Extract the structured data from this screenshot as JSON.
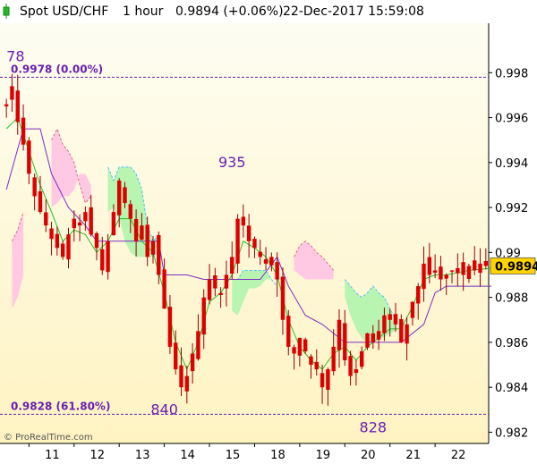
{
  "header": {
    "symbol": "Spot USD/CHF",
    "timeframe": "1 hour",
    "price_change": "0.9894 (+0.06%)",
    "datetime": "22-Dec-2017 15:59:08"
  },
  "credit": "© ProRealTime.com",
  "chart_data": {
    "type": "candlestick",
    "ylim": [
      0.9815,
      1.0002
    ],
    "yticks": [
      "0.998",
      "0.996",
      "0.994",
      "0.992",
      "0.99",
      "0.988",
      "0.986",
      "0.984",
      "0.982"
    ],
    "ytick_values": [
      0.998,
      0.996,
      0.994,
      0.992,
      0.99,
      0.988,
      0.986,
      0.984,
      0.982
    ],
    "xticks": [
      "11",
      "12",
      "13",
      "14",
      "15",
      "18",
      "19",
      "20",
      "21",
      "22"
    ],
    "xtick_bars": [
      8,
      16,
      24,
      32,
      40,
      48,
      56,
      64,
      72,
      80
    ],
    "total_bars": 86,
    "last_price": "0.9894",
    "last_price_value": 0.9894,
    "fib_levels": [
      {
        "label": "0.9978 (0.00%)",
        "value": 0.9978
      },
      {
        "label": "0.9828 (61.80%)",
        "value": 0.9828
      }
    ],
    "annotations": [
      {
        "text": "78",
        "bar": 0,
        "value": 0.9985
      },
      {
        "text": "935",
        "bar": 40,
        "value": 0.9938
      },
      {
        "text": "840",
        "bar": 28,
        "value": 0.9828
      },
      {
        "text": "828",
        "bar": 65,
        "value": 0.982
      }
    ],
    "close_path": [
      [
        0,
        0.9965
      ],
      [
        1,
        0.9974
      ],
      [
        2,
        0.9958
      ],
      [
        3,
        0.9948
      ],
      [
        4,
        0.9935
      ],
      [
        5,
        0.9925
      ],
      [
        6,
        0.9918
      ],
      [
        7,
        0.9912
      ],
      [
        8,
        0.9906
      ],
      [
        9,
        0.9902
      ],
      [
        10,
        0.9898
      ],
      [
        11,
        0.9908
      ],
      [
        12,
        0.9915
      ],
      [
        13,
        0.9912
      ],
      [
        14,
        0.9918
      ],
      [
        15,
        0.9908
      ],
      [
        16,
        0.9902
      ],
      [
        17,
        0.9892
      ],
      [
        18,
        0.9905
      ],
      [
        19,
        0.9918
      ],
      [
        20,
        0.9932
      ],
      [
        21,
        0.9922
      ],
      [
        22,
        0.9915
      ],
      [
        23,
        0.9905
      ],
      [
        24,
        0.9912
      ],
      [
        25,
        0.9898
      ],
      [
        26,
        0.9905
      ],
      [
        27,
        0.989
      ],
      [
        28,
        0.9875
      ],
      [
        29,
        0.9858
      ],
      [
        30,
        0.9848
      ],
      [
        31,
        0.984
      ],
      [
        32,
        0.9845
      ],
      [
        33,
        0.9855
      ],
      [
        34,
        0.9865
      ],
      [
        35,
        0.988
      ],
      [
        36,
        0.9888
      ],
      [
        37,
        0.9884
      ],
      [
        38,
        0.9882
      ],
      [
        39,
        0.989
      ],
      [
        40,
        0.9898
      ],
      [
        41,
        0.9915
      ],
      [
        42,
        0.9912
      ],
      [
        43,
        0.9905
      ],
      [
        44,
        0.9902
      ],
      [
        45,
        0.9898
      ],
      [
        46,
        0.9895
      ],
      [
        47,
        0.9898
      ],
      [
        48,
        0.9888
      ],
      [
        49,
        0.987
      ],
      [
        50,
        0.9858
      ],
      [
        51,
        0.9855
      ],
      [
        52,
        0.9862
      ],
      [
        53,
        0.9856
      ],
      [
        54,
        0.985
      ],
      [
        55,
        0.9848
      ],
      [
        56,
        0.984
      ],
      [
        57,
        0.9848
      ],
      [
        58,
        0.9858
      ],
      [
        59,
        0.987
      ],
      [
        60,
        0.9852
      ],
      [
        61,
        0.9845
      ],
      [
        62,
        0.9848
      ],
      [
        63,
        0.9856
      ],
      [
        64,
        0.9864
      ],
      [
        65,
        0.986
      ],
      [
        66,
        0.9865
      ],
      [
        67,
        0.9872
      ],
      [
        68,
        0.987
      ],
      [
        69,
        0.9868
      ],
      [
        70,
        0.986
      ],
      [
        71,
        0.9868
      ],
      [
        72,
        0.9878
      ],
      [
        73,
        0.9885
      ],
      [
        74,
        0.9895
      ],
      [
        75,
        0.989
      ],
      [
        76,
        0.9892
      ],
      [
        77,
        0.9888
      ],
      [
        78,
        0.989
      ],
      [
        79,
        0.9892
      ],
      [
        80,
        0.9893
      ],
      [
        81,
        0.989
      ],
      [
        82,
        0.9894
      ],
      [
        83,
        0.9892
      ],
      [
        84,
        0.9895
      ],
      [
        85,
        0.9894
      ]
    ],
    "green_cloud": [
      {
        "x": [
          18,
          27
        ],
        "top": [
          0.9938,
          0.9932,
          0.9938,
          0.9938,
          0.9938,
          0.9935,
          0.9928,
          0.9912,
          0.9905,
          0.9908
        ],
        "bottom": [
          0.9918,
          0.992,
          0.9915,
          0.9905,
          0.99,
          0.9898,
          0.9898,
          0.9898,
          0.9898,
          0.9902
        ]
      },
      {
        "x": [
          40,
          48
        ],
        "top": [
          0.9888,
          0.9888,
          0.9892,
          0.9892,
          0.9892,
          0.9892,
          0.9892,
          0.9888,
          0.9885
        ],
        "bottom": [
          0.9874,
          0.9872,
          0.9878,
          0.9884,
          0.9884,
          0.9885,
          0.9888,
          0.9888,
          0.9885
        ]
      },
      {
        "x": [
          60,
          69
        ],
        "top": [
          0.9888,
          0.9885,
          0.9882,
          0.988,
          0.9882,
          0.9885,
          0.9882,
          0.988,
          0.9875,
          0.987
        ],
        "bottom": [
          0.988,
          0.9872,
          0.9866,
          0.9862,
          0.986,
          0.986,
          0.9862,
          0.9862,
          0.9864,
          0.9865
        ]
      }
    ],
    "pink_cloud": [
      {
        "x": [
          1,
          3
        ],
        "top": [
          0.9905,
          0.991,
          0.9918
        ],
        "bottom": [
          0.9875,
          0.988,
          0.989
        ]
      },
      {
        "x": [
          8,
          15
        ],
        "top": [
          0.995,
          0.9955,
          0.9948,
          0.9945,
          0.994,
          0.993,
          0.9922,
          0.9925
        ],
        "bottom": [
          0.992,
          0.9922,
          0.9925,
          0.9925,
          0.9928,
          0.9935,
          0.9935,
          0.993
        ]
      },
      {
        "x": [
          51,
          58
        ],
        "top": [
          0.9898,
          0.9903,
          0.9905,
          0.9903,
          0.99,
          0.9898,
          0.9895,
          0.9892
        ],
        "bottom": [
          0.9892,
          0.989,
          0.9888,
          0.9888,
          0.9888,
          0.9888,
          0.9888,
          0.9888
        ]
      }
    ],
    "kijun": [
      [
        0,
        0.9928
      ],
      [
        3,
        0.9955
      ],
      [
        6,
        0.9955
      ],
      [
        8,
        0.9935
      ],
      [
        11,
        0.992
      ],
      [
        14,
        0.9912
      ],
      [
        16,
        0.9905
      ],
      [
        18,
        0.9905
      ],
      [
        20,
        0.9905
      ],
      [
        24,
        0.9905
      ],
      [
        27,
        0.9905
      ],
      [
        28,
        0.989
      ],
      [
        29,
        0.989
      ],
      [
        32,
        0.989
      ],
      [
        35,
        0.9888
      ],
      [
        38,
        0.9888
      ],
      [
        40,
        0.9888
      ],
      [
        45,
        0.9888
      ],
      [
        48,
        0.9898
      ],
      [
        50,
        0.9885
      ],
      [
        53,
        0.9872
      ],
      [
        56,
        0.9868
      ],
      [
        60,
        0.986
      ],
      [
        62,
        0.986
      ],
      [
        66,
        0.986
      ],
      [
        70,
        0.986
      ],
      [
        74,
        0.9868
      ],
      [
        76,
        0.9882
      ],
      [
        78,
        0.9885
      ],
      [
        86,
        0.9885
      ]
    ],
    "tenkan": [
      [
        0,
        0.9955
      ],
      [
        2,
        0.996
      ],
      [
        4,
        0.9945
      ],
      [
        6,
        0.993
      ],
      [
        8,
        0.9918
      ],
      [
        10,
        0.9905
      ],
      [
        12,
        0.991
      ],
      [
        14,
        0.9908
      ],
      [
        16,
        0.99
      ],
      [
        18,
        0.9905
      ],
      [
        20,
        0.9915
      ],
      [
        22,
        0.9915
      ],
      [
        24,
        0.9905
      ],
      [
        26,
        0.99
      ],
      [
        28,
        0.9882
      ],
      [
        30,
        0.986
      ],
      [
        32,
        0.9848
      ],
      [
        34,
        0.986
      ],
      [
        36,
        0.9878
      ],
      [
        38,
        0.9882
      ],
      [
        40,
        0.989
      ],
      [
        42,
        0.9905
      ],
      [
        44,
        0.9902
      ],
      [
        46,
        0.9898
      ],
      [
        48,
        0.989
      ],
      [
        50,
        0.987
      ],
      [
        52,
        0.9858
      ],
      [
        54,
        0.9852
      ],
      [
        56,
        0.9848
      ],
      [
        58,
        0.9855
      ],
      [
        60,
        0.9858
      ],
      [
        62,
        0.9852
      ],
      [
        64,
        0.9858
      ],
      [
        66,
        0.9862
      ],
      [
        68,
        0.9866
      ],
      [
        70,
        0.9866
      ],
      [
        72,
        0.9876
      ],
      [
        74,
        0.9888
      ],
      [
        76,
        0.989
      ],
      [
        78,
        0.989
      ],
      [
        82,
        0.9892
      ],
      [
        86,
        0.9893
      ]
    ],
    "colors": {
      "candle": "#dd0000",
      "wick": "#990000",
      "green_cloud": "#b8f5b0",
      "pink_cloud": "#ffc9e3",
      "kijun": "#7a2fc4",
      "tenkan": "#23c423",
      "fib_line": "#6a1fb0",
      "last_price_box": "#ffd400",
      "bg_top": "#fdfbe2",
      "bg_bottom": "#fff4c8"
    }
  }
}
